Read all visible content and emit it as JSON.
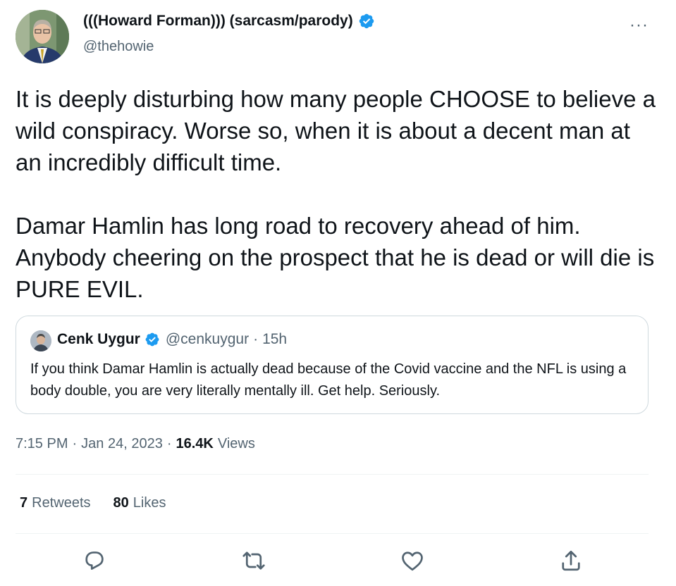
{
  "author": {
    "name": "(((Howard Forman))) (sarcasm/parody)",
    "handle": "@thehowie"
  },
  "more_label": "···",
  "tweet": {
    "paragraphs": [
      "It is deeply disturbing how many people CHOOSE to believe a wild conspiracy. Worse so, when it is about a decent man at an incredibly difficult time.",
      "Damar Hamlin has long road to recovery ahead of him. Anybody cheering on the prospect that he is dead or will die is PURE EVIL."
    ]
  },
  "quote": {
    "name": "Cenk Uygur",
    "handle": "@cenkuygur",
    "dot": "·",
    "time": "15h",
    "text": "If you think Damar Hamlin is actually dead because of the Covid vaccine and the NFL is using a body double, you are very literally mentally ill. Get help. Seriously."
  },
  "meta": {
    "time": "7:15 PM",
    "sep": "·",
    "date": "Jan 24, 2023",
    "views_count": "16.4K",
    "views_label": "Views"
  },
  "stats": {
    "retweets_count": "7",
    "retweets_label": "Retweets",
    "likes_count": "80",
    "likes_label": "Likes"
  },
  "icons": {
    "verified": "verified-badge-icon",
    "reply": "reply-icon",
    "retweet": "retweet-icon",
    "like": "like-icon",
    "share": "share-icon"
  },
  "colors": {
    "verified": "#1d9bf0",
    "text": "#0f1419",
    "secondary": "#536471",
    "border": "#cfd9de"
  }
}
